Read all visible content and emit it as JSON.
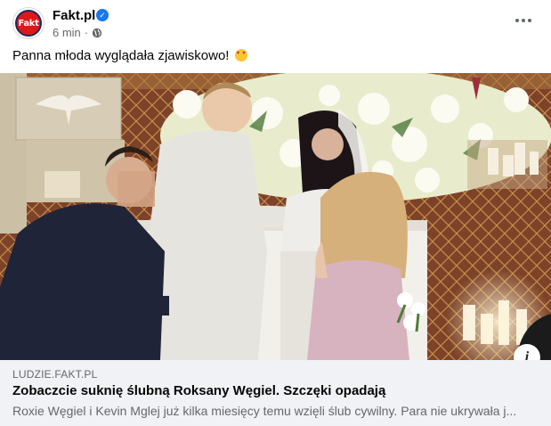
{
  "post": {
    "page_name": "Fakt.pl",
    "avatar_text": "Fakt",
    "time": "6 min",
    "separator": "·",
    "caption": "Panna młoda wyglądała zjawiskowo!",
    "emoji": "smiling-face-with-heart-eyes"
  },
  "link_preview": {
    "domain": "LUDZIE.FAKT.PL",
    "title": "Zobaczcie suknię ślubną Roksany Węgiel. Szczęki opadają",
    "description": "Roxie Węgiel i Kevin Mglej już kilka miesięcy temu wzięli ślub cywilny. Para nie ukrywała j..."
  },
  "icons": {
    "verified": "verified-badge-icon",
    "privacy": "globe-icon",
    "more": "more-options-icon",
    "info": "info-icon"
  },
  "colors": {
    "brand_red": "#e0161b",
    "verified_blue": "#1877f2",
    "link_box_bg": "#f0f2f5",
    "secondary_text": "#65676b"
  }
}
